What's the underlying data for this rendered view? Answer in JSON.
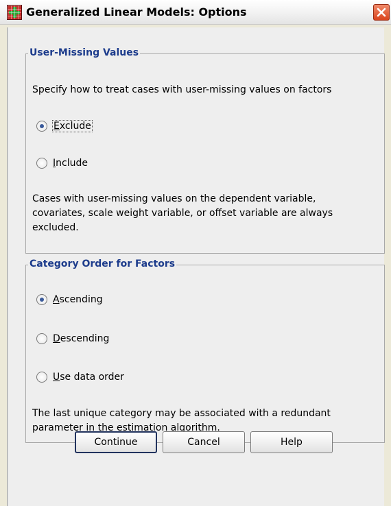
{
  "window": {
    "title": "Generalized Linear Models: Options"
  },
  "user_missing": {
    "group_title": "User-Missing Values",
    "instruction": "Specify how to treat cases with user-missing values on factors",
    "options": [
      {
        "label": "Exclude",
        "mnemonic": "E",
        "rest": "xclude",
        "selected": true
      },
      {
        "label": "Include",
        "mnemonic": "I",
        "rest": "nclude",
        "selected": false
      }
    ],
    "note_lines": [
      "Cases with user-missing values on the dependent variable,",
      "covariates, scale weight variable, or offset variable are always",
      "excluded."
    ]
  },
  "category_order": {
    "group_title": "Category Order for Factors",
    "options": [
      {
        "label": "Ascending",
        "mnemonic": "A",
        "rest": "scending",
        "selected": true
      },
      {
        "label": "Descending",
        "mnemonic": "D",
        "rest": "escending",
        "selected": false
      },
      {
        "label": "Use data order",
        "mnemonic": "U",
        "rest": "se data order",
        "selected": false
      }
    ],
    "note_lines": [
      "The last unique category may be associated with a redundant",
      "parameter in the estimation algorithm."
    ]
  },
  "buttons": {
    "continue": "Continue",
    "cancel": "Cancel",
    "help": "Help"
  },
  "icons": {
    "app": "spss-grid-plus-icon",
    "close": "close-icon"
  },
  "colors": {
    "group_title": "#1d3c8c",
    "close_button": "#d9431c",
    "background": "#eeeeee"
  }
}
